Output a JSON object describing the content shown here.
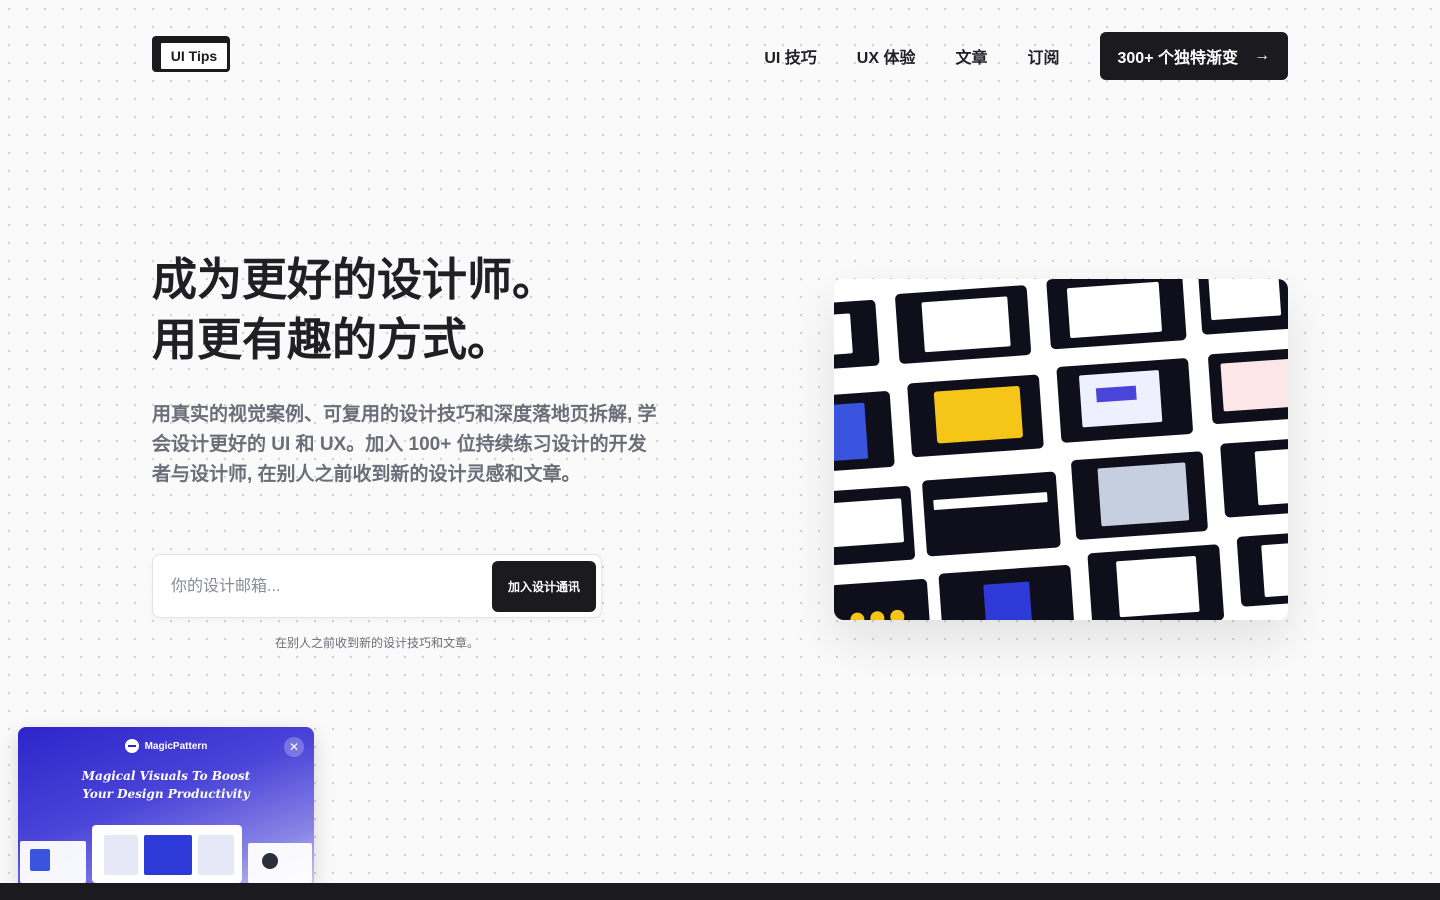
{
  "header": {
    "logo": "UI Tips",
    "nav": [
      "UI 技巧",
      "UX 体验",
      "文章",
      "订阅"
    ],
    "cta_label": "300+ 个独特渐变",
    "cta_icon": "arrow-right-icon"
  },
  "hero": {
    "title_line1": "成为更好的设计师。",
    "title_line2": "用更有趣的方式。",
    "description": "用真实的视觉案例、可复用的设计技巧和深度落地页拆解, 学会设计更好的 UI 和 UX。加入 100+ 位持续练习设计的开发者与设计师, 在别人之前收到新的设计灵感和文章。"
  },
  "signup": {
    "email_placeholder": "你的设计邮箱...",
    "email_value": "",
    "button_label": "加入设计通讯",
    "note": "在别人之前收到新的设计技巧和文章。"
  },
  "promo": {
    "brand": "MagicPattern",
    "headline_line1": "Magical Visuals To Boost",
    "headline_line2": "Your Design Productivity",
    "close_icon": "close-icon"
  },
  "colors": {
    "dark": "#1b1b1f",
    "text": "#1f1f24",
    "muted": "#6b6e78",
    "promo_accent": "#2d24c9",
    "highlight_yellow": "#f5c518"
  }
}
